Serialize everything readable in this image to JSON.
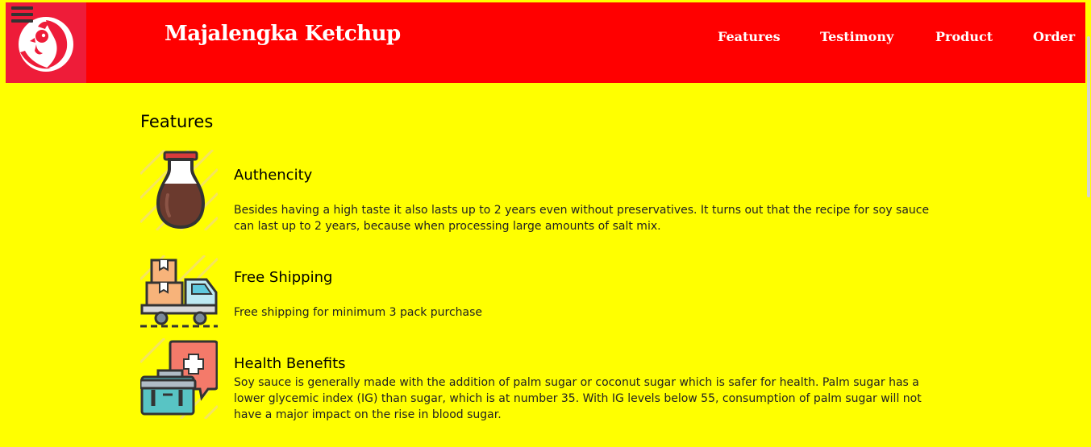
{
  "header": {
    "brand": "Majalengka Ketchup",
    "nav": [
      {
        "label": "Features"
      },
      {
        "label": "Testimony"
      },
      {
        "label": "Product"
      },
      {
        "label": "Order"
      }
    ]
  },
  "features": {
    "title": "Features",
    "items": [
      {
        "title": "Authencity",
        "description": "Besides having a high taste it also lasts up to 2 years even without preservatives. It turns out that the recipe for soy sauce can last up to 2 years, because when processing large amounts of salt mix.",
        "icon": "soy-sauce-bottle-icon"
      },
      {
        "title": "Free Shipping",
        "description": "Free shipping for minimum 3 pack purchase",
        "icon": "delivery-truck-icon"
      },
      {
        "title": "Health Benefits",
        "description": "Soy sauce is generally made with the addition of palm sugar or coconut sugar which is safer for health. Palm sugar has a lower glycemic index (IG) than sugar, which is at number 35. With IG levels below 55, consumption of palm sugar will not have a major impact on the rise in blood sugar.",
        "icon": "medical-kit-icon"
      }
    ]
  },
  "colors": {
    "page_background": "#ffff00",
    "header_background": "#ff0000",
    "logo_background": "#ee1c39"
  }
}
